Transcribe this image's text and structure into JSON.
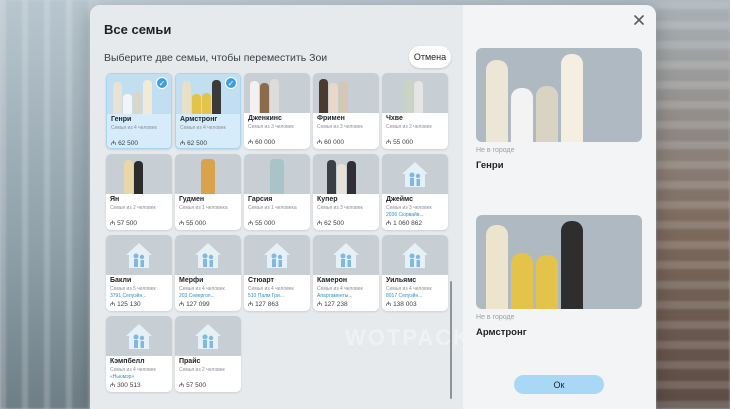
{
  "dialog": {
    "title": "Все семьи",
    "subtitle": "Выберите две семьи, чтобы переместить Зои",
    "cancel_label": "Отмена",
    "ok_label": "Ок"
  },
  "families": [
    {
      "name": "Генри",
      "size": "Семья из 4 человек",
      "address": "",
      "money": "₼ 62 500",
      "selected": true
    },
    {
      "name": "Армстронг",
      "size": "Семья из 4 человек",
      "address": "",
      "money": "₼ 62 500",
      "selected": true
    },
    {
      "name": "Дженкинс",
      "size": "Семья из 3 человек",
      "address": "",
      "money": "₼ 60 000",
      "selected": false
    },
    {
      "name": "Фримен",
      "size": "Семья из 3 человек",
      "address": "",
      "money": "₼ 60 000",
      "selected": false
    },
    {
      "name": "Чхве",
      "size": "Семья из 2 человек",
      "address": "",
      "money": "₼ 55 000",
      "selected": false
    },
    {
      "name": "Ян",
      "size": "Семья из 2 человек",
      "address": "",
      "money": "₼ 57 500",
      "selected": false
    },
    {
      "name": "Гудмен",
      "size": "Семья из 1 человека",
      "address": "",
      "money": "₼ 55 000",
      "selected": false
    },
    {
      "name": "Гарсия",
      "size": "Семья из 1 человека",
      "address": "",
      "money": "₼ 55 000",
      "selected": false
    },
    {
      "name": "Купер",
      "size": "Семья из 3 человек",
      "address": "",
      "money": "₼ 62 500",
      "selected": false
    },
    {
      "name": "Джеймс",
      "size": "Семья из 3 человек",
      "address": "2036 Сюрвайв...",
      "money": "₼ 1 060 862",
      "selected": false
    },
    {
      "name": "Бакли",
      "size": "Семья из 5 человек",
      "address": "3791 Селуэйн...",
      "money": "₼ 125 130",
      "selected": false
    },
    {
      "name": "Мерфи",
      "size": "Семья из 4 человек",
      "address": "203 Севергол...",
      "money": "₼ 127 099",
      "selected": false
    },
    {
      "name": "Стюарт",
      "size": "Семья из 4 человек",
      "address": "510 Палм Гри...",
      "money": "₼ 127 863",
      "selected": false
    },
    {
      "name": "Камерон",
      "size": "Семья из 4 человек",
      "address": "Апартаменты...",
      "money": "₼ 127 238",
      "selected": false
    },
    {
      "name": "Уильямс",
      "size": "Семья из 4 человек",
      "address": "8017 Селуэйн...",
      "money": "₼ 138 003",
      "selected": false
    },
    {
      "name": "Кэмпбелл",
      "size": "Семья из 4 человек",
      "address": "«Ньюмэр»",
      "money": "₼ 300 513",
      "selected": false
    },
    {
      "name": "Прайс",
      "size": "Семья из 2 человек",
      "address": "",
      "money": "₼ 57 500",
      "selected": false
    }
  ],
  "selection": [
    {
      "location": "Не в городе",
      "name": "Генри"
    },
    {
      "location": "Не в городе",
      "name": "Армстронг"
    }
  ],
  "watermark": "WOTPACK.RU",
  "colors": {
    "accent": "#3d9ee0",
    "selected_card": "#d6ecfa",
    "ok_button": "#a9d8f6"
  }
}
